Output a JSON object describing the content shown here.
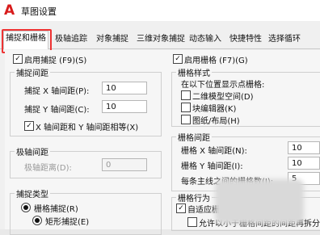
{
  "window": {
    "title": "草图设置"
  },
  "tabs": [
    {
      "label": "捕捉和栅格"
    },
    {
      "label": "极轴追踪"
    },
    {
      "label": "对象捕捉"
    },
    {
      "label": "三维对象捕捉"
    },
    {
      "label": "动态输入"
    },
    {
      "label": "快捷特性"
    },
    {
      "label": "选择循环"
    }
  ],
  "snap": {
    "enable_label": "启用捕捉 (F9)(S)",
    "enabled": true,
    "spacing_title": "捕捉间距",
    "x_label": "捕捉 X 轴间距(P):",
    "x_value": "10",
    "y_label": "捕捉 Y 轴间距(C):",
    "y_value": "10",
    "equal_label": "X 轴间距和 Y 轴间距相等(X)",
    "equal_checked": true,
    "polar_title": "极轴间距",
    "polar_label": "极轴距离(D):",
    "polar_value": "0",
    "type_title": "捕捉类型",
    "grid_snap_label": "栅格捕捉(R)",
    "rect_snap_label": "矩形捕捉(E)"
  },
  "grid": {
    "enable_label": "启用栅格 (F7)(G)",
    "enabled": true,
    "style_title": "栅格样式",
    "style_desc": "在以下位置显示点栅格:",
    "opt1_label": "二维模型空间(D)",
    "opt2_label": "块编辑器(K)",
    "opt3_label": "图纸/布局(H)",
    "spacing_title": "栅格间距",
    "x_label": "栅格 X 轴间距(N):",
    "x_value": "10",
    "y_label": "栅格 Y 轴间距(I):",
    "y_value": "10",
    "major_label": "每条主线之间的栅格数(J):",
    "major_value": "5",
    "behavior_title": "栅格行为",
    "adaptive_label": "自适应栅格(A)",
    "subdiv_label": "允许以小于栅格间距的间距再拆分"
  }
}
